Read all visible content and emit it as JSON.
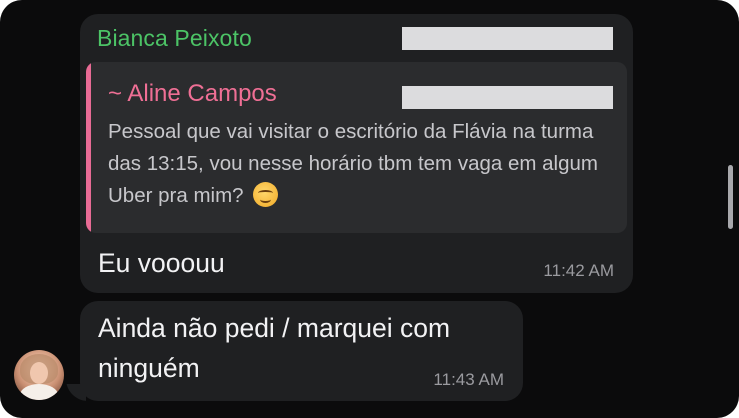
{
  "messages": [
    {
      "sender": "Bianca Peixoto",
      "quoted": {
        "author": "~ Aline Campos",
        "text": "Pessoal que vai visitar o escritório da Flávia na turma das 13:15, vou nesse horário tbm tem vaga em algum Uber pra mim?",
        "emoji": "smiling-face-with-smiling-eyes"
      },
      "text": "Eu vooouu",
      "time": "11:42 AM"
    },
    {
      "text": "Ainda não pedi / marquei com ninguém",
      "time": "11:43 AM"
    }
  ],
  "colors": {
    "background": "#0b0b0c",
    "bubble": "#1f2022",
    "quote_background": "#2b2c2e",
    "sender_name": "#4cc366",
    "quoted_author": "#ef6f95",
    "quote_bar": "#e86b95",
    "timestamp": "#9a9a9f"
  }
}
